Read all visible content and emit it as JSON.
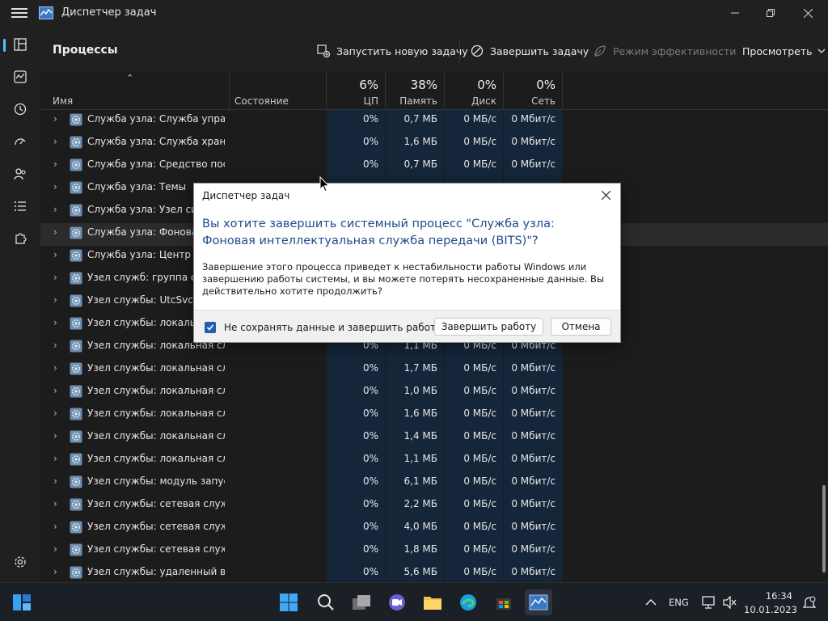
{
  "window": {
    "title": "Диспетчер задач"
  },
  "header": {
    "page_title": "Процессы",
    "run_new_task": "Запустить новую задачу",
    "end_task": "Завершить задачу",
    "efficiency_mode": "Режим эффективности",
    "view": "Просмотреть"
  },
  "columns": {
    "name": "Имя",
    "status": "Состояние",
    "cpu": {
      "label": "ЦП",
      "pct": "6%"
    },
    "memory": {
      "label": "Память",
      "pct": "38%"
    },
    "disk": {
      "label": "Диск",
      "pct": "0%"
    },
    "network": {
      "label": "Сеть",
      "pct": "0%"
    }
  },
  "rows": [
    {
      "name": "Служба узла: Служба управ...",
      "cpu": "0%",
      "mem": "0,7 МБ",
      "disk": "0 МБ/с",
      "net": "0 Мбит/с"
    },
    {
      "name": "Служба узла: Служба храни...",
      "cpu": "0%",
      "mem": "1,6 МБ",
      "disk": "0 МБ/с",
      "net": "0 Мбит/с"
    },
    {
      "name": "Служба узла: Средство пост...",
      "cpu": "0%",
      "mem": "0,7 МБ",
      "disk": "0 МБ/с",
      "net": "0 Мбит/с"
    },
    {
      "name": "Служба узла: Темы",
      "cpu": "",
      "mem": "",
      "disk": "",
      "net": ""
    },
    {
      "name": "Служба узла: Узел систе",
      "cpu": "",
      "mem": "",
      "disk": "",
      "net": ""
    },
    {
      "name": "Служба узла: Фоновая и",
      "cpu": "",
      "mem": "",
      "disk": "",
      "net": ""
    },
    {
      "name": "Служба узла: Центр обн",
      "cpu": "",
      "mem": "",
      "disk": "",
      "net": ""
    },
    {
      "name": "Узел служб: группа слу",
      "cpu": "",
      "mem": "",
      "disk": "",
      "net": ""
    },
    {
      "name": "Узел службы: UtcSvc",
      "cpu": "",
      "mem": "",
      "disk": "",
      "net": ""
    },
    {
      "name": "Узел службы: локальна",
      "cpu": "",
      "mem": "",
      "disk": "",
      "net": ""
    },
    {
      "name": "Узел службы: локальная слу...",
      "cpu": "0%",
      "mem": "1,1 МБ",
      "disk": "0 МБ/с",
      "net": "0 Мбит/с"
    },
    {
      "name": "Узел службы: локальная слу...",
      "cpu": "0%",
      "mem": "1,7 МБ",
      "disk": "0 МБ/с",
      "net": "0 Мбит/с"
    },
    {
      "name": "Узел службы: локальная слу...",
      "cpu": "0%",
      "mem": "1,0 МБ",
      "disk": "0 МБ/с",
      "net": "0 Мбит/с"
    },
    {
      "name": "Узел службы: локальная слу...",
      "cpu": "0%",
      "mem": "1,6 МБ",
      "disk": "0 МБ/с",
      "net": "0 Мбит/с"
    },
    {
      "name": "Узел службы: локальная слу...",
      "cpu": "0%",
      "mem": "1,4 МБ",
      "disk": "0 МБ/с",
      "net": "0 Мбит/с"
    },
    {
      "name": "Узел службы: локальная слу...",
      "cpu": "0%",
      "mem": "1,1 МБ",
      "disk": "0 МБ/с",
      "net": "0 Мбит/с"
    },
    {
      "name": "Узел службы: модуль запуск...",
      "cpu": "0%",
      "mem": "6,1 МБ",
      "disk": "0 МБ/с",
      "net": "0 Мбит/с"
    },
    {
      "name": "Узел службы: сетевая служба",
      "cpu": "0%",
      "mem": "2,2 МБ",
      "disk": "0 МБ/с",
      "net": "0 Мбит/с"
    },
    {
      "name": "Узел службы: сетевая служба",
      "cpu": "0%",
      "mem": "4,0 МБ",
      "disk": "0 МБ/с",
      "net": "0 Мбит/с"
    },
    {
      "name": "Узел службы: сетевая служба",
      "cpu": "0%",
      "mem": "1,8 МБ",
      "disk": "0 МБ/с",
      "net": "0 Мбит/с"
    },
    {
      "name": "Узел службы: удаленный вы...",
      "cpu": "0%",
      "mem": "5,6 МБ",
      "disk": "0 МБ/с",
      "net": "0 Мбит/с"
    }
  ],
  "dialog": {
    "title": "Диспетчер задач",
    "heading": "Вы хотите завершить системный процесс \"Служба узла: Фоновая интеллектуальная служба передачи (BITS)\"?",
    "body": "Завершение этого процесса приведет к нестабильности работы Windows или завершению работы системы, и вы можете потерять несохраненные данные. Вы действительно хотите продолжить?",
    "checkbox_label": "Не сохранять данные и завершить работу.",
    "checkbox_checked": true,
    "ok_label": "Завершить работу",
    "cancel_label": "Отмена"
  },
  "taskbar": {
    "language": "ENG",
    "time": "16:34",
    "date": "10.01.2023"
  },
  "colors": {
    "accent": "#4cc2ff",
    "dialog_heading": "#1f4a8c",
    "checkbox": "#1f5fb6"
  }
}
